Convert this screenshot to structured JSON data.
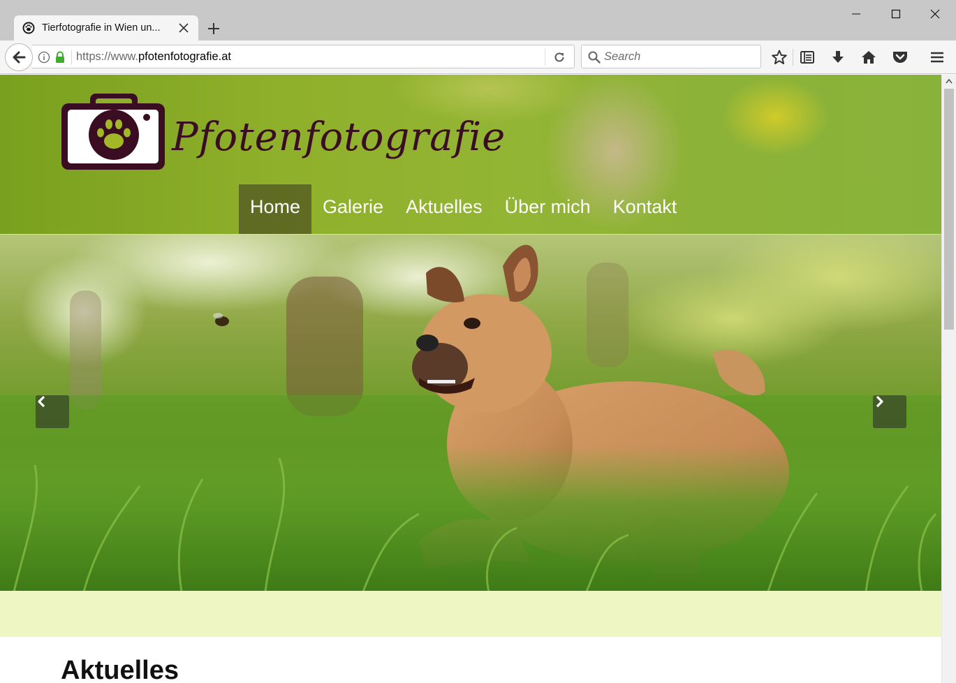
{
  "browser": {
    "tab_title": "Tierfotografie in Wien un...",
    "url_prefix": "https://www.",
    "url_domain": "pfotenfotografie.at",
    "search_placeholder": "Search",
    "icons": [
      "back-icon",
      "info-icon",
      "lock-icon",
      "reload-icon",
      "search-icon",
      "bookmark-star-icon",
      "library-icon",
      "download-icon",
      "home-icon",
      "pocket-icon",
      "menu-icon",
      "minimize-icon",
      "maximize-icon",
      "close-window-icon"
    ],
    "colors": {
      "tabstrip": "#c8c8c8",
      "toolbar": "#f5f5f5",
      "lock": "#3fae2a"
    }
  },
  "site": {
    "logo_text": "Pfotenfotografie",
    "nav": [
      {
        "label": "Home",
        "active": true
      },
      {
        "label": "Galerie",
        "active": false
      },
      {
        "label": "Aktuelles",
        "active": false
      },
      {
        "label": "Über mich",
        "active": false
      },
      {
        "label": "Kontakt",
        "active": false
      }
    ],
    "section_title": "Aktuelles",
    "colors": {
      "logo": "#3b0d23",
      "band": "#eef6c4",
      "header_green": "#8fb02a"
    }
  }
}
